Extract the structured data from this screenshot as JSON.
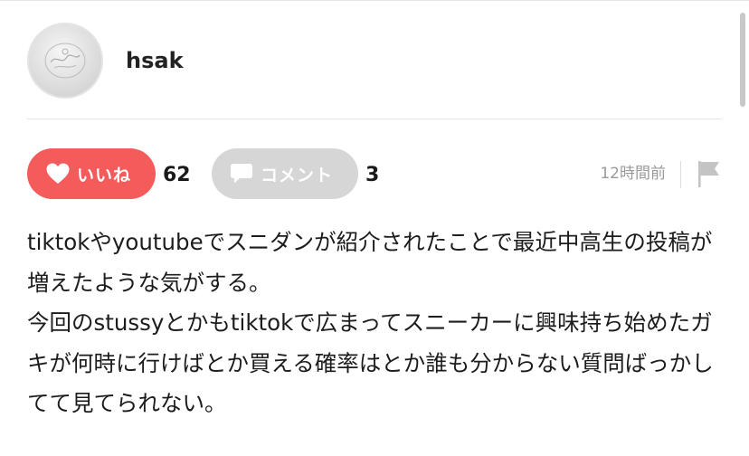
{
  "profile": {
    "username": "hsak"
  },
  "actions": {
    "like_label": "いいね",
    "like_count": "62",
    "comment_label": "コメント",
    "comment_count": "3",
    "timestamp": "12時間前"
  },
  "post": {
    "paragraphs": [
      "tiktokやyoutubeでスニダンが紹介されたことで最近中高生の投稿が増えたような気がする。",
      "今回のstussyとかもtiktokで広まってスニーカーに興味持ち始めたガキが何時に行けばとか買える確率はとか誰も分からない質問ばっかしてて見てられない。"
    ]
  },
  "colors": {
    "like_button": "#f45b5b",
    "comment_button": "#d6d6d6",
    "timestamp": "#9a9a9a",
    "divider": "#e6e6e6"
  },
  "icons": {
    "like": "heart-icon",
    "comment": "speech-bubble-icon",
    "report": "flag-icon"
  }
}
